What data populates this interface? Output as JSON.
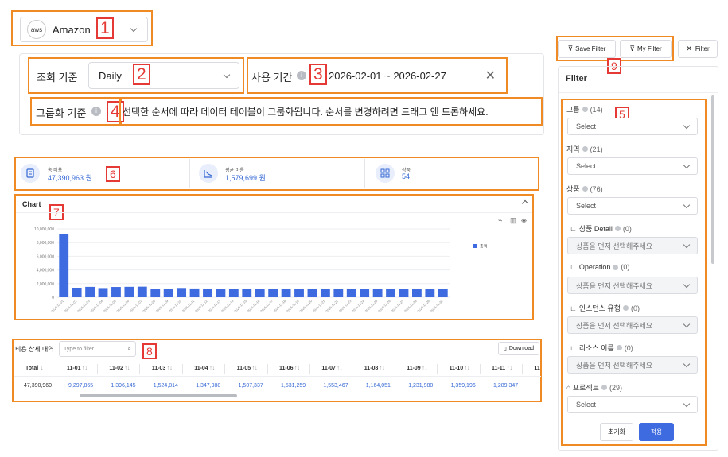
{
  "account": {
    "logo": "aws",
    "name": "Amazon"
  },
  "query_basis": {
    "label": "조회 기준",
    "value": "Daily"
  },
  "usage_period": {
    "label": "사용 기간",
    "value": "2026-02-01 ~ 2026-02-27"
  },
  "grouping": {
    "label": "그룹화 기준",
    "description": "선택한 순서에 따라 데이터 테이블이 그룹화됩니다. 순서를 변경하려면 드래그 앤 드롭하세요."
  },
  "kpis": [
    {
      "label": "총 비용",
      "value": "47,390,963 원",
      "icon": "receipt-icon"
    },
    {
      "label": "평균 비용",
      "value": "1,579,699 원",
      "icon": "trend-chart-icon"
    },
    {
      "label": "상품",
      "value": "54",
      "icon": "grid-icon"
    }
  ],
  "chart_panel": {
    "title": "Chart",
    "collapse_icon": "chevron-up-icon"
  },
  "chart_data": {
    "type": "bar",
    "categories": [
      "2025-11-01",
      "2025-11-02",
      "2025-11-03",
      "2025-11-04",
      "2025-11-05",
      "2025-11-06",
      "2025-11-07",
      "2025-11-08",
      "2025-11-09",
      "2025-11-10",
      "2025-11-11",
      "2025-11-12",
      "2025-11-13",
      "2025-11-14",
      "2025-11-15",
      "2025-11-16",
      "2025-11-17",
      "2025-11-18",
      "2025-11-19",
      "2025-11-20",
      "2025-11-21",
      "2025-11-22",
      "2025-11-23",
      "2025-11-24",
      "2025-11-25",
      "2025-11-26",
      "2025-11-27",
      "2025-11-28",
      "2025-11-29",
      "2025-11-30"
    ],
    "series": [
      {
        "name": "총액",
        "values": [
          9297865,
          1396145,
          1524814,
          1347988,
          1507337,
          1531259,
          1553467,
          1164051,
          1231980,
          1359196,
          1289347,
          1280000,
          1270000,
          1260000,
          1250000,
          1240000,
          1250000,
          1260000,
          1270000,
          1260000,
          1250000,
          1240000,
          1250000,
          1260000,
          1250000,
          1240000,
          1250000,
          1260000,
          1250000,
          1240000
        ]
      }
    ],
    "yticks": [
      "0",
      "2,000,000",
      "4,000,000",
      "6,000,000",
      "8,000,000",
      "10,000,000"
    ],
    "ylim": [
      0,
      10000000
    ],
    "color": "#3f6be0",
    "legend_position": "right"
  },
  "table": {
    "title": "비용 상세 내역",
    "search_placeholder": "Type to filter...",
    "download_label": "Download",
    "total_header": "Total",
    "total_value": "47,390,960",
    "columns": [
      {
        "label": "11-01",
        "value": "9,297,865"
      },
      {
        "label": "11-02",
        "value": "1,396,145"
      },
      {
        "label": "11-03",
        "value": "1,524,814"
      },
      {
        "label": "11-04",
        "value": "1,347,988"
      },
      {
        "label": "11-05",
        "value": "1,507,337"
      },
      {
        "label": "11-06",
        "value": "1,531,259"
      },
      {
        "label": "11-07",
        "value": "1,553,467"
      },
      {
        "label": "11-08",
        "value": "1,164,051"
      },
      {
        "label": "11-09",
        "value": "1,231,980"
      },
      {
        "label": "11-10",
        "value": "1,359,196"
      },
      {
        "label": "11-11",
        "value": "1,289,347"
      },
      {
        "label": "11",
        "value": ""
      }
    ]
  },
  "filter_toolbar": {
    "save": "Save Filter",
    "my": "My Filter",
    "clear": "Filter"
  },
  "filter_panel": {
    "title": "Filter",
    "fields": [
      {
        "label": "그룹",
        "count": "(14)",
        "value": "Select"
      },
      {
        "label": "지역",
        "count": "(21)",
        "value": "Select"
      },
      {
        "label": "상품",
        "count": "(76)",
        "value": "Select"
      },
      {
        "label": "상품 Detail",
        "count": "(0)",
        "value": "상품을 먼저 선택해주세요"
      },
      {
        "label": "Operation",
        "count": "(0)",
        "value": "상품을 먼저 선택해주세요"
      },
      {
        "label": "인스턴스 유형",
        "count": "(0)",
        "value": "상품을 먼저 선택해주세요"
      },
      {
        "label": "리소스 이름",
        "count": "(0)",
        "value": "상품을 먼저 선택해주세요"
      },
      {
        "label": "프로젝트",
        "count": "(29)",
        "value": "Select"
      }
    ],
    "reset": "초기화",
    "apply": "적용"
  },
  "annotations": [
    "1",
    "2",
    "3",
    "4",
    "5",
    "6",
    "7",
    "8",
    "9"
  ]
}
